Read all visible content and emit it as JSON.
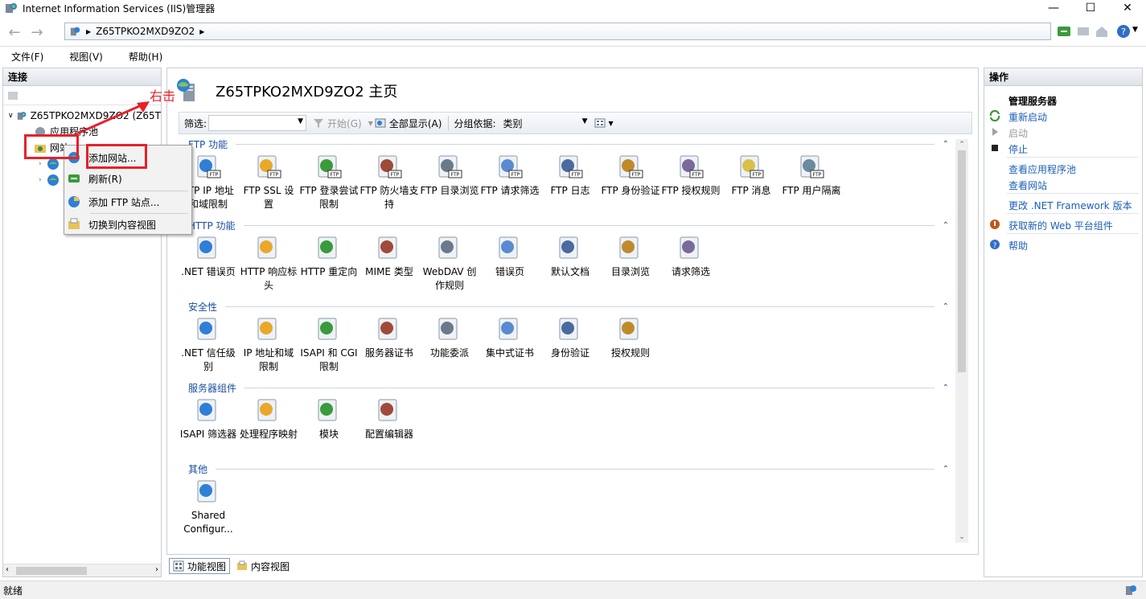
{
  "window": {
    "title": "Internet Information Services (IIS)管理器",
    "controls": [
      "minimize",
      "maximize",
      "close"
    ]
  },
  "address": {
    "crumb": "Z65TPKO2MXD9ZO2"
  },
  "menubar": {
    "items": [
      "文件(F)",
      "视图(V)",
      "帮助(H)"
    ]
  },
  "connections": {
    "header": "连接",
    "tree": {
      "server": "Z65TPKO2MXD9ZO2 (Z65T",
      "app_pools": "应用程序池",
      "sites": "网站"
    }
  },
  "context_menu": {
    "items": [
      "添加网站...",
      "刷新(R)",
      "添加 FTP 站点...",
      "切换到内容视图"
    ]
  },
  "annotation": {
    "label": "右击"
  },
  "main": {
    "title": "Z65TPKO2MXD9ZO2 主页",
    "filter_label": "筛选:",
    "start_label": "开始(G)",
    "show_all_label": "全部显示(A)",
    "group_by_label": "分组依据:",
    "group_by_value": "类别",
    "groups": [
      {
        "title": "FTP 功能",
        "items": [
          "FTP IP 地址和域限制",
          "FTP SSL 设置",
          "FTP 登录尝试限制",
          "FTP 防火墙支持",
          "FTP 目录浏览",
          "FTP 请求筛选",
          "FTP 日志",
          "FTP 身份验证",
          "FTP 授权规则",
          "FTP 消息",
          "FTP 用户隔离"
        ]
      },
      {
        "title": "HTTP 功能",
        "items": [
          ".NET 错误页",
          "HTTP 响应标头",
          "HTTP 重定向",
          "MIME 类型",
          "WebDAV 创作规则",
          "错误页",
          "默认文档",
          "目录浏览",
          "请求筛选"
        ]
      },
      {
        "title": "安全性",
        "items": [
          ".NET 信任级别",
          "IP 地址和域限制",
          "ISAPI 和 CGI 限制",
          "服务器证书",
          "功能委派",
          "集中式证书",
          "身份验证",
          "授权规则"
        ]
      },
      {
        "title": "服务器组件",
        "items": [
          "ISAPI 筛选器",
          "处理程序映射",
          "模块",
          "配置编辑器"
        ]
      },
      {
        "title": "其他",
        "items": [
          "Shared Configur..."
        ]
      }
    ],
    "view_tabs": [
      "功能视图",
      "内容视图"
    ]
  },
  "actions": {
    "header": "操作",
    "section_title": "管理服务器",
    "items": [
      {
        "label": "重新启动",
        "enabled": true
      },
      {
        "label": "启动",
        "enabled": false
      },
      {
        "label": "停止",
        "enabled": true
      },
      {
        "label": "查看应用程序池",
        "enabled": true
      },
      {
        "label": "查看网站",
        "enabled": true
      },
      {
        "label": "更改 .NET Framework 版本",
        "enabled": true
      },
      {
        "label": "获取新的 Web 平台组件",
        "enabled": true
      },
      {
        "label": "帮助",
        "enabled": true
      }
    ]
  },
  "statusbar": {
    "text": "就绪"
  },
  "colors": {
    "link": "#1c5fb8",
    "group_title": "#1a4fa0",
    "annotation_red": "#e8202a"
  }
}
